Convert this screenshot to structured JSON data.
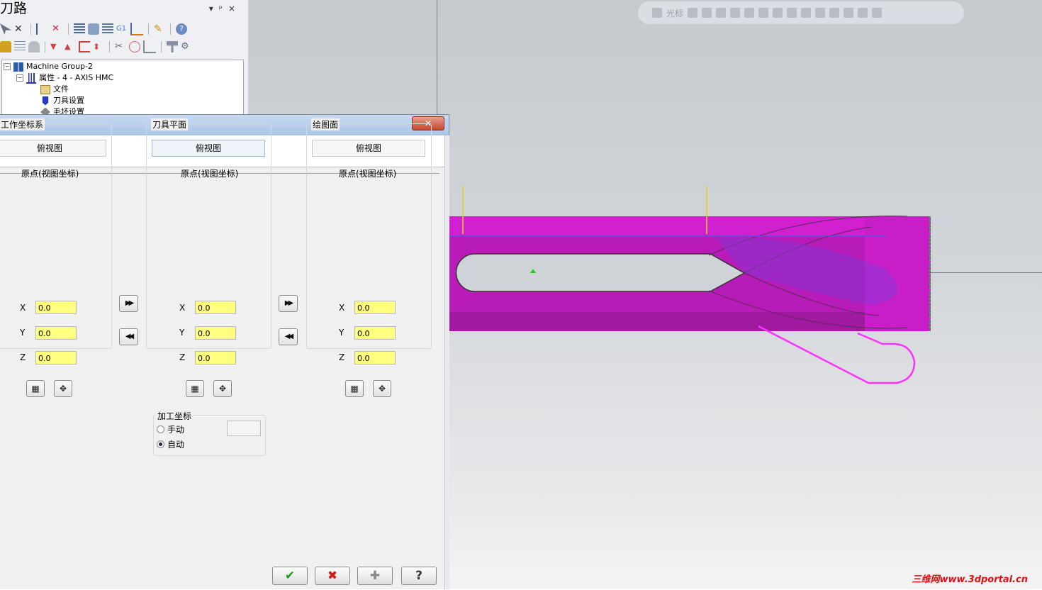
{
  "toolpath_panel": {
    "title": "刀路",
    "window_controls": [
      "▾",
      "ᵖ",
      "×"
    ],
    "tree": [
      {
        "label": "Machine Group-2",
        "icon": "machine-group-icon"
      },
      {
        "label": "属性 - 4 - AXIS HMC",
        "icon": "properties-icon"
      },
      {
        "label": "文件",
        "icon": "folder-icon"
      },
      {
        "label": "刀具设置",
        "icon": "tool-settings-icon"
      },
      {
        "label": "毛坯设置",
        "icon": "stock-setup-icon"
      }
    ]
  },
  "viewport": {
    "toolbar_label": "光标",
    "watermark": "三维网www.3dportal.cn"
  },
  "dialog": {
    "close_label": "✕",
    "groups": [
      {
        "title": "工作坐标系",
        "view_name": "俯视图",
        "origin_label": "原点(视图坐标)",
        "x": "0.0",
        "y": "0.0",
        "z": "0.0"
      },
      {
        "title": "刀具平面",
        "view_name": "俯视图",
        "origin_label": "原点(视图坐标)",
        "x": "0.0",
        "y": "0.0",
        "z": "0.0"
      },
      {
        "title": "绘图面",
        "view_name": "俯视图",
        "origin_label": "原点(视图坐标)",
        "x": "0.0",
        "y": "0.0",
        "z": "0.0"
      }
    ],
    "axis_labels": {
      "x": "X",
      "y": "Y",
      "z": "Z"
    },
    "machine_coords": {
      "title": "加工坐标",
      "manual": "手动",
      "auto": "自动",
      "selected": "auto"
    },
    "buttons": {
      "ok": "✔",
      "cancel": "✖",
      "add": "✚",
      "help": "?"
    }
  },
  "colors": {
    "part": "#c21cc2",
    "field": "#ffff7f",
    "toolpath": "#ff30ff"
  }
}
